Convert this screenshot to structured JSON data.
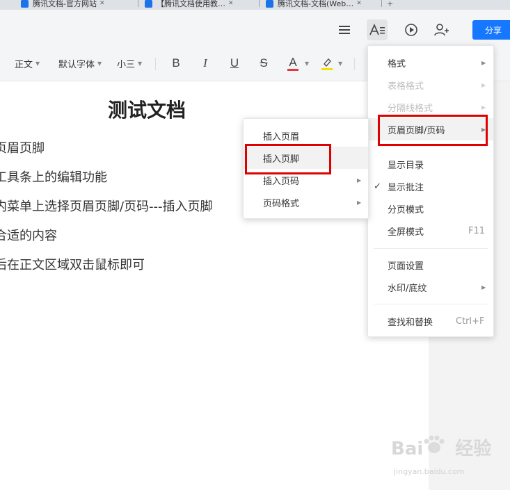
{
  "browser": {
    "tabs": [
      {
        "title": "腾讯文档-官方网站"
      },
      {
        "title": "【腾讯文档使用教…"
      },
      {
        "title": "腾讯文档-文档(Web…"
      }
    ],
    "new_tab": "+"
  },
  "appbar": {
    "share_label": "分享",
    "icons": [
      "menu-icon",
      "text-format-icon",
      "play-icon",
      "add-user-icon"
    ]
  },
  "toolbar": {
    "style_value": "正文",
    "font_value": "默认字体",
    "size_value": "小三",
    "bold": "B",
    "italic": "I",
    "underline": "U",
    "strike": "S",
    "font_color": "A",
    "accent_red": "#e53935",
    "highlight_yellow": "#f5e100"
  },
  "document": {
    "title": "测试文档",
    "lines": [
      "页眉页脚",
      "工具条上的编辑功能",
      "内菜单上选择页眉页脚/页码---插入页脚",
      "合适的内容",
      "后在正文区域双击鼠标即可"
    ]
  },
  "menu": {
    "items": [
      {
        "label": "格式",
        "arrow": true,
        "disabled": false
      },
      {
        "label": "表格格式",
        "arrow": true,
        "disabled": true
      },
      {
        "label": "分隔线格式",
        "arrow": true,
        "disabled": true
      },
      {
        "label": "页眉页脚/页码",
        "arrow": true,
        "disabled": false
      },
      {
        "label": "显示目录"
      },
      {
        "label": "显示批注",
        "checked": true
      },
      {
        "label": "分页模式"
      },
      {
        "label": "全屏模式",
        "shortcut": "F11"
      },
      {
        "label": "页面设置"
      },
      {
        "label": "水印/底纹",
        "arrow": true
      },
      {
        "label": "查找和替换",
        "shortcut": "Ctrl+F"
      }
    ]
  },
  "submenu": {
    "items": [
      {
        "label": "插入页眉"
      },
      {
        "label": "插入页脚"
      },
      {
        "label": "插入页码",
        "arrow": true
      },
      {
        "label": "页码格式",
        "arrow": true
      }
    ]
  },
  "watermark": {
    "brand": "Bai",
    "brand2": "经验",
    "domain": "jingyan.baidu.com"
  }
}
